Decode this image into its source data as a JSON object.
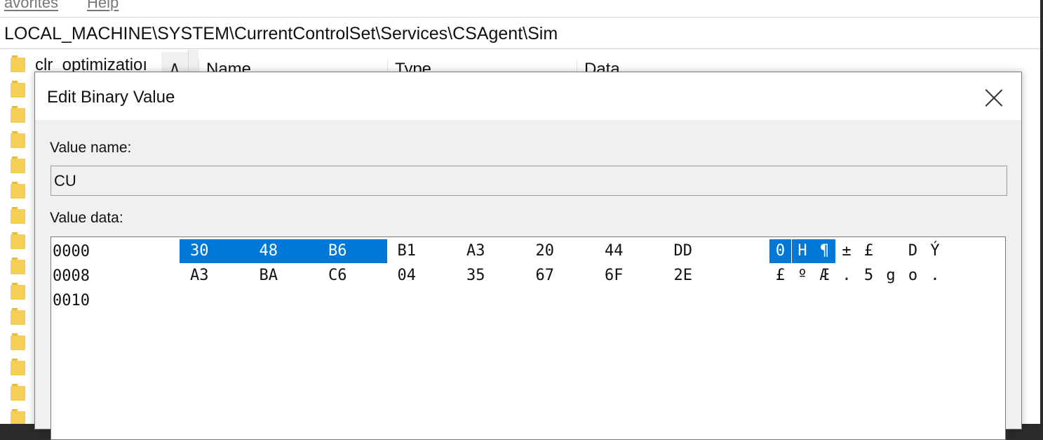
{
  "menu": {
    "items": [
      "avorites",
      "Help"
    ]
  },
  "address": {
    "path": "LOCAL_MACHINE\\SYSTEM\\CurrentControlSet\\Services\\CSAgent\\Sim"
  },
  "tree": {
    "visible_label": "clr_optimizatioı"
  },
  "list": {
    "columns": [
      "Name",
      "Type",
      "Data"
    ]
  },
  "dialog": {
    "title": "Edit Binary Value",
    "value_name_label": "Value name:",
    "value_name": "CU",
    "value_data_label": "Value data:",
    "rows": [
      {
        "offset": "0000",
        "bytes": [
          "30",
          "48",
          "B6",
          "B1",
          "A3",
          "20",
          "44",
          "DD"
        ],
        "ascii": [
          "0",
          "H",
          "¶",
          "±",
          "£",
          " ",
          "D",
          "Ý"
        ]
      },
      {
        "offset": "0008",
        "bytes": [
          "A3",
          "BA",
          "C6",
          "04",
          "35",
          "67",
          "6F",
          "2E"
        ],
        "ascii": [
          "£",
          "º",
          "Æ",
          ".",
          "5",
          "g",
          "o",
          "."
        ]
      },
      {
        "offset": "0010",
        "bytes": [],
        "ascii": []
      }
    ],
    "selected_byte_count": 3
  },
  "colors": {
    "selection": "#0078d7",
    "folder": "#f4cf55"
  }
}
